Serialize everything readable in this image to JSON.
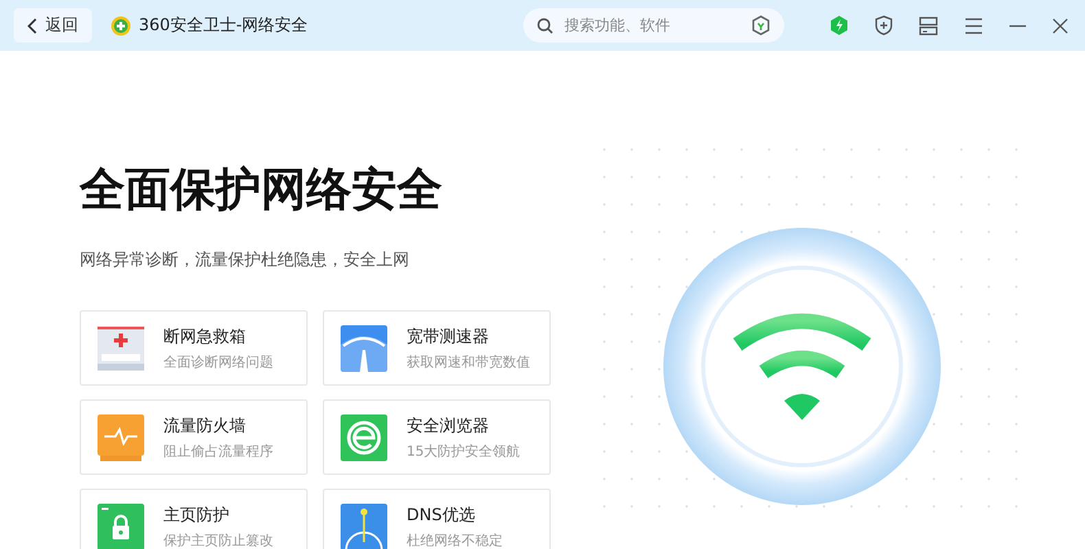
{
  "titlebar": {
    "back": "返回",
    "title": "360安全卫士-网络安全",
    "search": {
      "placeholder": "搜索功能、软件"
    }
  },
  "hero": {
    "title": "全面保护网络安全",
    "subtitle": "网络异常诊断，流量保护杜绝隐患，安全上网"
  },
  "tools": [
    {
      "kind": "firstaid",
      "name": "断网急救箱",
      "desc": "全面诊断网络问题"
    },
    {
      "kind": "speed",
      "name": "宽带测速器",
      "desc": "获取网速和带宽数值"
    },
    {
      "kind": "firewall",
      "name": "流量防火墙",
      "desc": "阻止偷占流量程序"
    },
    {
      "kind": "browser",
      "name": "安全浏览器",
      "desc": "15大防护安全领航"
    },
    {
      "kind": "homepage",
      "name": "主页防护",
      "desc": "保护主页防止篡改"
    },
    {
      "kind": "dns",
      "name": "DNS优选",
      "desc": "杜绝网络不稳定"
    }
  ]
}
